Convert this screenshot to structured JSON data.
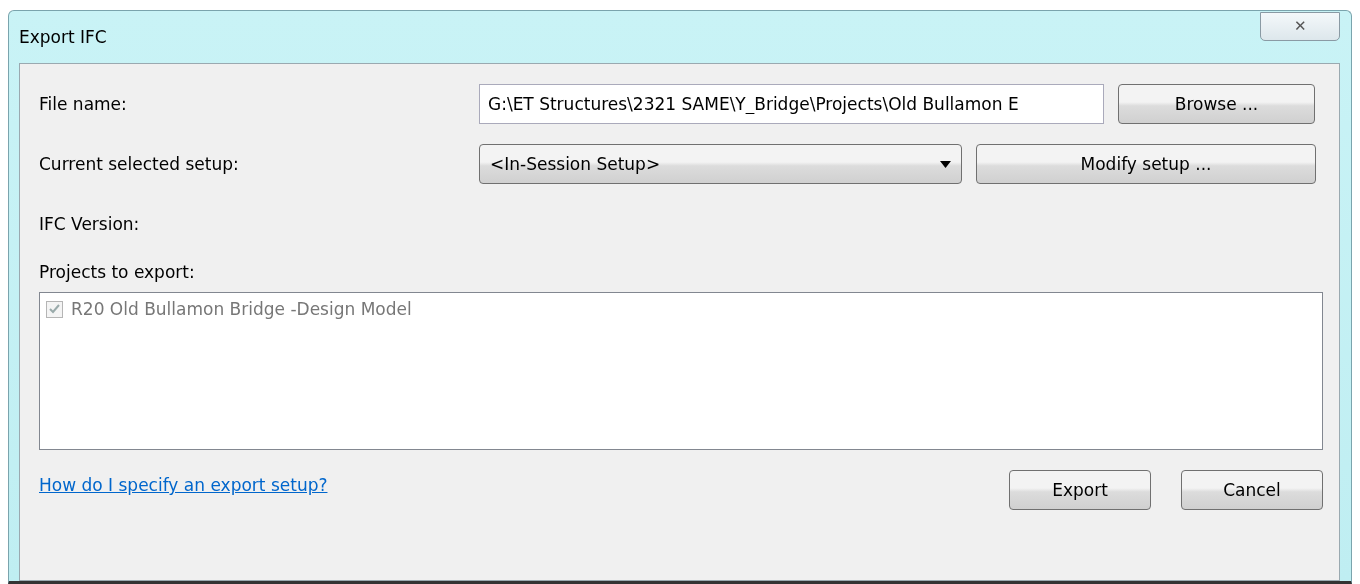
{
  "window": {
    "title": "Export IFC",
    "close": "✕"
  },
  "file_name": {
    "label": "File name:",
    "value": "G:\\ET Structures\\2321 SAME\\Y_Bridge\\Projects\\Old Bullamon E",
    "browse": "Browse ..."
  },
  "setup": {
    "label": "Current selected setup:",
    "value": "<In-Session Setup>",
    "modify": "Modify setup ..."
  },
  "ifc_version": {
    "label": "IFC Version:"
  },
  "projects": {
    "label": "Projects to export:",
    "items": [
      {
        "label": "R20 Old Bullamon Bridge -Design Model",
        "checked": true,
        "disabled": true
      }
    ]
  },
  "help_link": "How do I specify an export setup?",
  "buttons": [
    "Export",
    "Cancel"
  ]
}
